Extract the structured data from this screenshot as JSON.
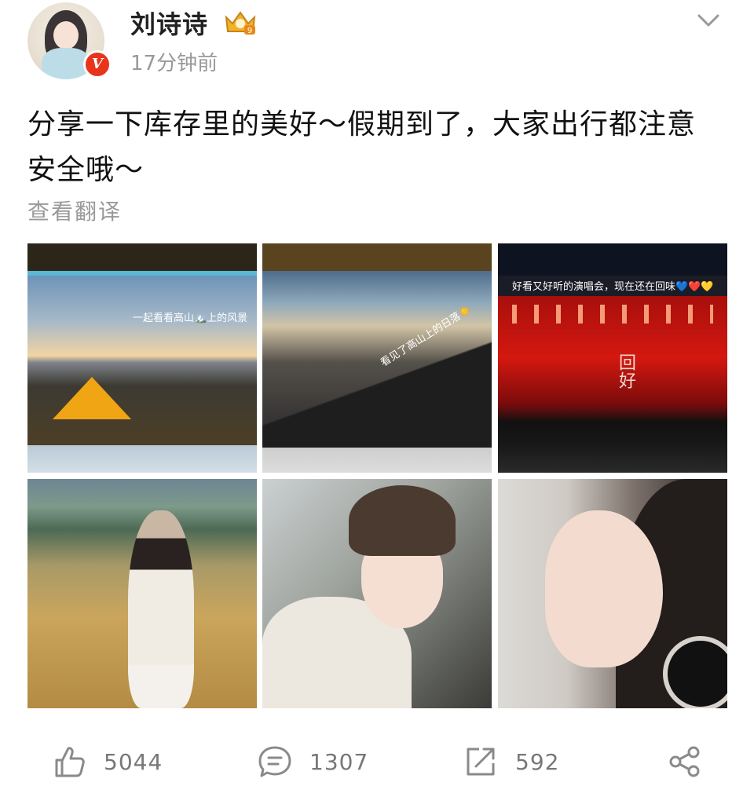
{
  "post": {
    "username": "刘诗诗",
    "time": "17分钟前",
    "content": "分享一下库存里的美好～假期到了，大家出行都注意安全哦～",
    "translate_label": "查看翻译",
    "verified_badge": "V",
    "level_badge": "9"
  },
  "images": [
    {
      "caption": "一起看看高山🏔️上的风景",
      "alt": "camping tent at mountain sunset"
    },
    {
      "caption": "看见了高山上的日落☀️",
      "alt": "mountain ridge at sunset"
    },
    {
      "caption": "好看又好听的演唱会，现在还在回味💙❤️💛",
      "stage_text": "回好",
      "alt": "concert stage with red lights"
    },
    {
      "alt": "woman standing in golden grassland"
    },
    {
      "alt": "woman in knit beanie inside car"
    },
    {
      "alt": "woman portrait with earring"
    }
  ],
  "actions": {
    "like": "5044",
    "comment": "1307",
    "repost": "592"
  },
  "colors": {
    "accent_red": "#e8341b",
    "muted_text": "#999999",
    "icon_gray": "#8a8a8a"
  },
  "icons": {
    "like": "thumbs-up-icon",
    "comment": "comment-bubble-icon",
    "repost": "share-out-icon",
    "share": "share-nodes-icon",
    "more": "chevron-down-icon"
  }
}
